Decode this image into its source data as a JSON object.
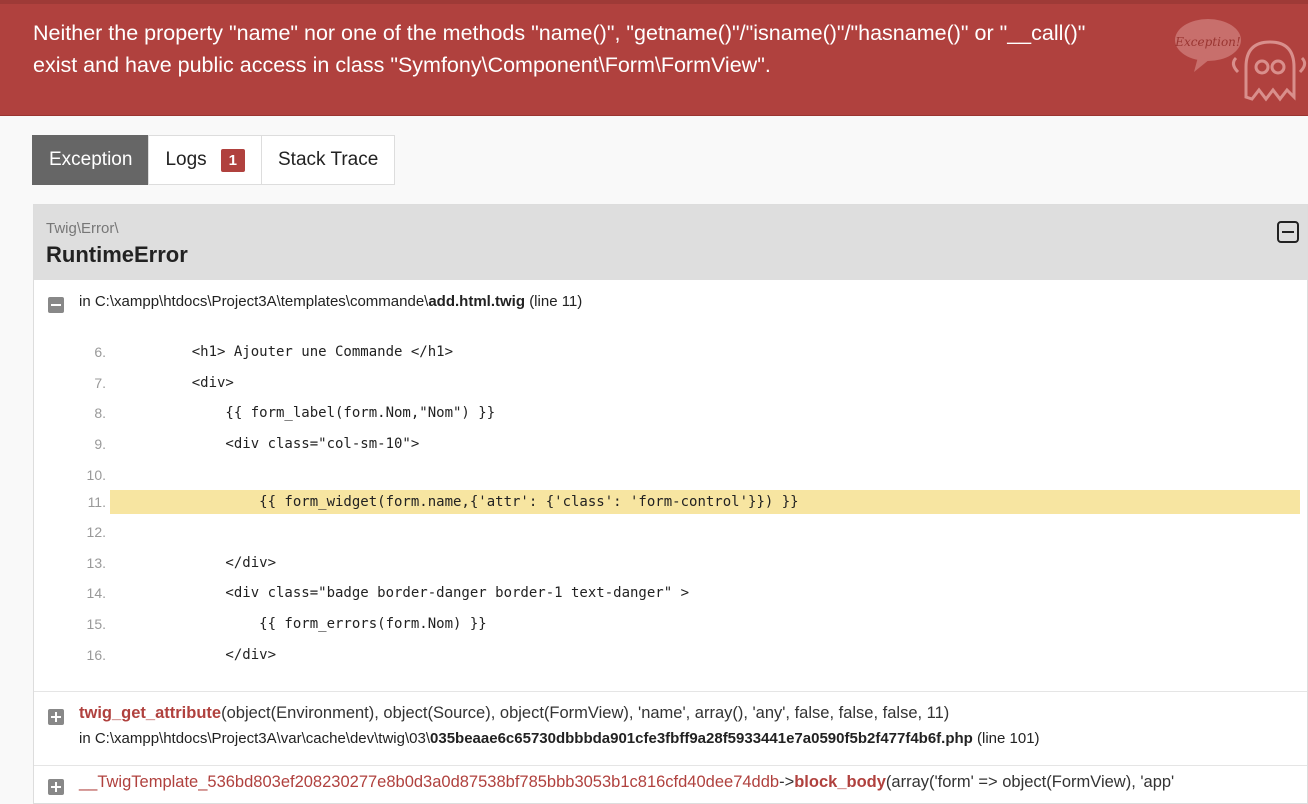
{
  "header": {
    "message_line1": "Neither the property \"name\" nor one of the methods \"name()\", \"getname()\"/\"isname()\"/\"hasname()\" or \"__call()\"",
    "message_line2": "exist and have public access in class \"Symfony\\Component\\Form\\FormView\".",
    "ghost_text": "Exception!"
  },
  "tabs": [
    {
      "label": "Exception"
    },
    {
      "label": "Logs",
      "badge": "1"
    },
    {
      "label": "Stack Trace"
    }
  ],
  "exception": {
    "namespace": "Twig\\Error\\",
    "class": "RuntimeError",
    "location_prefix": "in C:\\xampp\\htdocs\\Project3A\\templates\\commande\\",
    "location_file": "add.html.twig",
    "location_line": "(line 11)"
  },
  "code_lines": [
    {
      "num": "6.",
      "text": "    <h1> Ajouter une Commande </h1>"
    },
    {
      "num": "7.",
      "text": "    <div>"
    },
    {
      "num": "8.",
      "text": "        {{ form_label(form.Nom,\"Nom\") }}"
    },
    {
      "num": "9.",
      "text": "        <div class=\"col-sm-10\">"
    },
    {
      "num": "10.",
      "text": ""
    },
    {
      "num": "11.",
      "text": "            {{ form_widget(form.name,{'attr': {'class': 'form-control'}}) }}"
    },
    {
      "num": "12.",
      "text": ""
    },
    {
      "num": "13.",
      "text": "        </div>"
    },
    {
      "num": "14.",
      "text": "        <div class=\"badge border-danger border-1 text-danger\" >"
    },
    {
      "num": "15.",
      "text": "            {{ form_errors(form.Nom) }}"
    },
    {
      "num": "16.",
      "text": "        </div>"
    }
  ],
  "trace": [
    {
      "fn": "twig_get_attribute",
      "args_open": "(",
      "args_body": "object(Environment), object(Source), object(FormView), 'name', array(), 'any', false, false, false, 11)",
      "loc_prefix": "in C:\\xampp\\htdocs\\Project3A\\var\\cache\\dev\\twig\\03\\",
      "loc_file": "035beaae6c65730dbbbda901cfe3fbff9a28f5933441e7a0590f5b2f477f4b6f.php",
      "loc_line": "(line 101)"
    },
    {
      "fn": "__TwigTemplate_536bd803ef208230277e8b0d3a0d87538bf785bbb3053b1c816cfd40dee74ddb",
      "arrow": "->",
      "method": "block_body",
      "args": "(array('form' => object(FormView), 'app'"
    }
  ]
}
